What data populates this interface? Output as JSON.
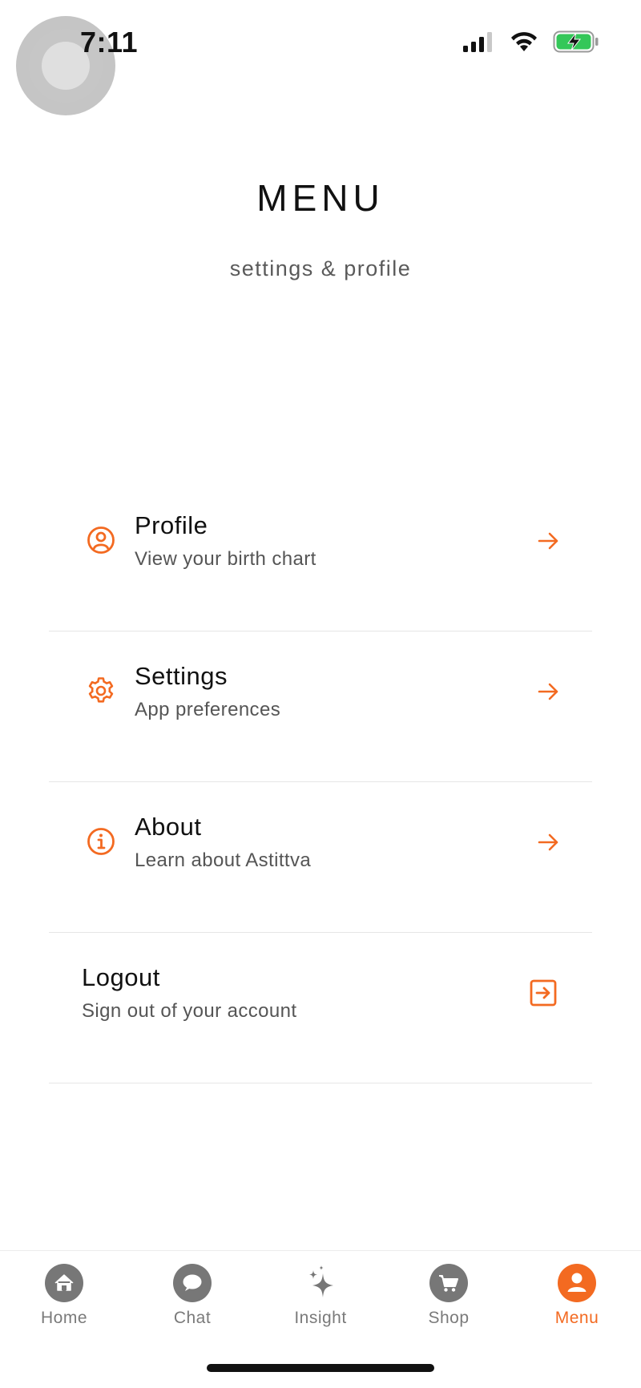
{
  "status_bar": {
    "time": "7:11"
  },
  "header": {
    "title": "MENU",
    "subtitle": "settings & profile"
  },
  "menu": {
    "items": [
      {
        "title": "Profile",
        "description": "View your birth chart",
        "icon": "user-circle-icon"
      },
      {
        "title": "Settings",
        "description": "App preferences",
        "icon": "gear-icon"
      },
      {
        "title": "About",
        "description": "Learn about Astittva",
        "icon": "info-circle-icon"
      },
      {
        "title": "Logout",
        "description": "Sign out of your account",
        "icon": "logout-icon"
      }
    ]
  },
  "tab_bar": {
    "tabs": [
      {
        "label": "Home",
        "icon": "home-icon",
        "active": false
      },
      {
        "label": "Chat",
        "icon": "chat-bubble-icon",
        "active": false
      },
      {
        "label": "Insight",
        "icon": "sparkle-icon",
        "active": false
      },
      {
        "label": "Shop",
        "icon": "cart-icon",
        "active": false
      },
      {
        "label": "Menu",
        "icon": "user-icon",
        "active": true
      }
    ]
  },
  "colors": {
    "accent": "#f36a21",
    "text_primary": "#111111",
    "text_secondary": "#555555",
    "tab_inactive": "#7a7a7a",
    "battery_green": "#34c759"
  }
}
